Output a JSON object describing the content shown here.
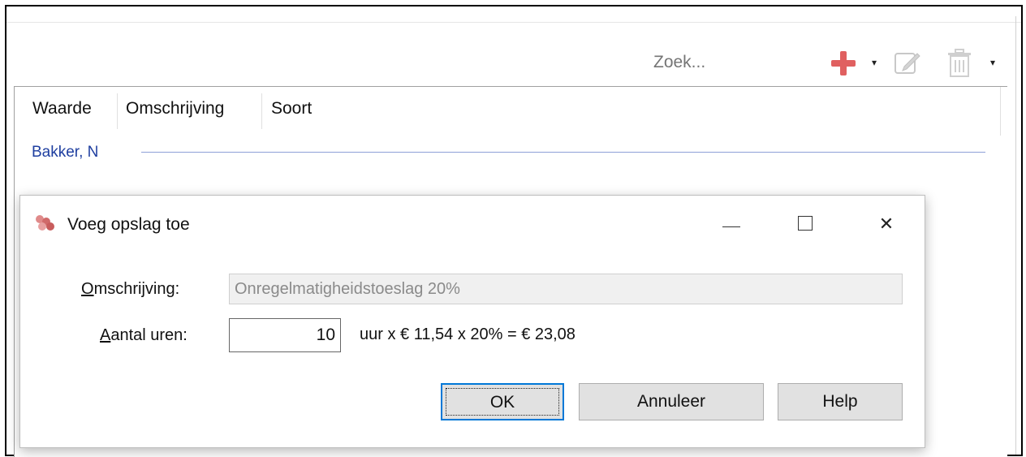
{
  "toolbar": {
    "search_placeholder": "Zoek...",
    "icons": [
      "plus-icon",
      "chevron-down-icon",
      "edit-icon",
      "trash-icon",
      "chevron-down-icon"
    ],
    "plus_color": "#e06060",
    "dropdown_glyph": "▾"
  },
  "grid": {
    "columns": [
      "Waarde",
      "Omschrijving",
      "Soort"
    ],
    "group_label": "Bakker, N",
    "group_color": "#1f3fa0"
  },
  "dialog": {
    "title": "Voeg opslag toe",
    "window_buttons": {
      "minimize": "—",
      "maximize": "☐",
      "close": "✕"
    },
    "omschrijving_label_accel": "O",
    "omschrijving_label_rest": "mschrijving:",
    "omschrijving_value": "Onregelmatigheidstoeslag 20%",
    "uren_label_accel": "A",
    "uren_label_rest": "antal uren:",
    "uren_value": "10",
    "calculation": "uur x € 11,54 x 20% = € 23,08",
    "buttons": {
      "ok": "OK",
      "cancel": "Annuleer",
      "help": "Help"
    },
    "accent_color": "#0078d7"
  }
}
